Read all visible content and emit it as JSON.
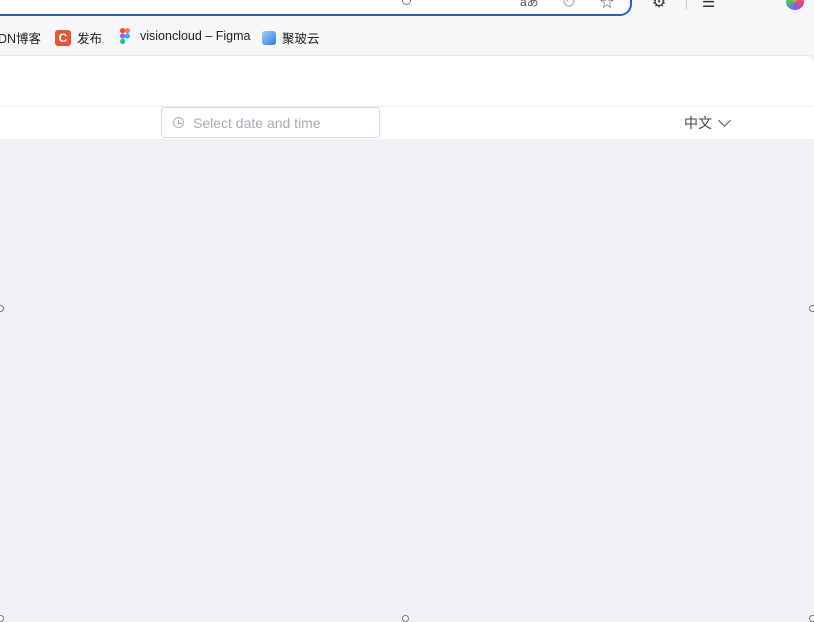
{
  "browser": {
    "address_icon_glyph": "⟵",
    "read_aloud_glyph": "aあ",
    "refresh_glyph": "↻",
    "favorite_glyph": "☆",
    "extensions_glyph": "⚙",
    "collections_glyph": "☰",
    "more_glyph": "···"
  },
  "bookmarks": [
    {
      "label": "DN博客",
      "icon": "partial-icon"
    },
    {
      "label": "发布",
      "icon": "csdn-c-icon",
      "glyph": "C"
    },
    {
      "label": "visioncloud – Figma",
      "icon": "figma-icon"
    },
    {
      "label": "聚玻云",
      "icon": "cloud-icon"
    }
  ],
  "toolbar": {
    "datetime_placeholder": "Select date and time",
    "language": "中文"
  },
  "colors": {
    "accent": "#1f62d6",
    "page_bg": "#f0f1f5",
    "placeholder": "#a8abb2"
  }
}
